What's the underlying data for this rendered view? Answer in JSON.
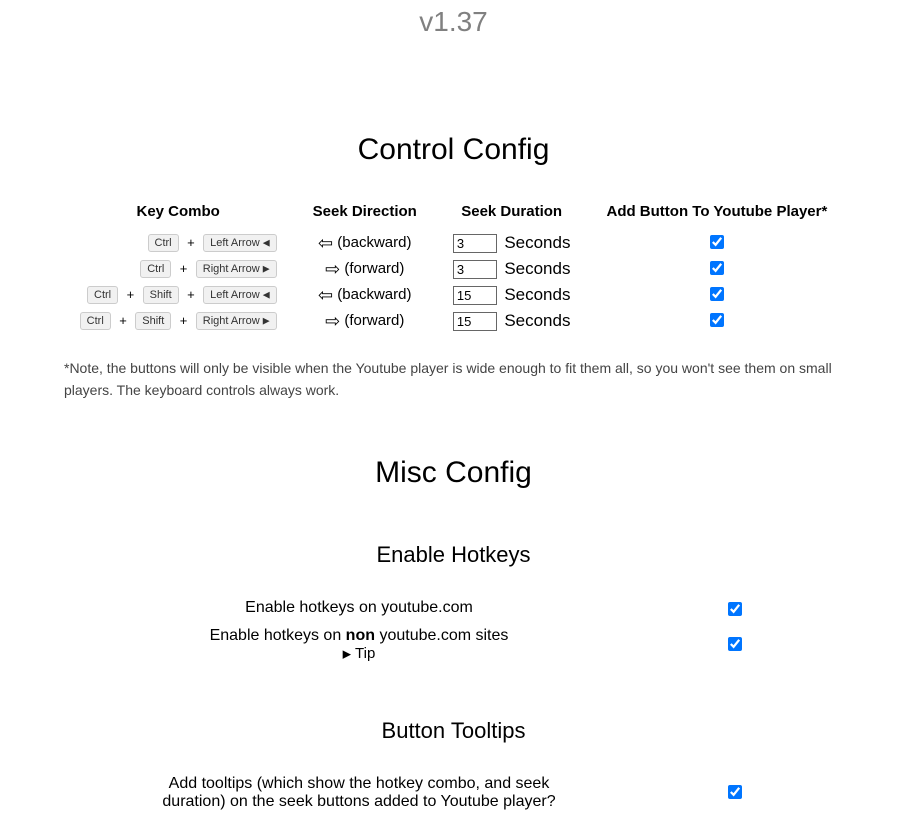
{
  "version": "v1.37",
  "control": {
    "title": "Control Config",
    "headers": {
      "combo": "Key Combo",
      "direction": "Seek Direction",
      "duration": "Seek Duration",
      "addbutton": "Add Button To Youtube Player*"
    },
    "keys": {
      "ctrl": "Ctrl",
      "shift": "Shift",
      "left": "Left Arrow",
      "right": "Right Arrow"
    },
    "plus": "+",
    "dir_backward": "(backward)",
    "dir_forward": "(forward)",
    "seconds_label": "Seconds",
    "rows": [
      {
        "seconds": "3"
      },
      {
        "seconds": "3"
      },
      {
        "seconds": "15"
      },
      {
        "seconds": "15"
      }
    ],
    "note": "*Note, the buttons will only be visible when the Youtube player is wide enough to fit them all, so you won't see them on small players. The keyboard controls always work."
  },
  "misc": {
    "title": "Misc Config",
    "hotkeys": {
      "title": "Enable Hotkeys",
      "row1_label": "Enable hotkeys on youtube.com",
      "row2_prefix": "Enable hotkeys on ",
      "row2_bold": "non",
      "row2_suffix": " youtube.com sites",
      "tip": "Tip"
    },
    "tooltips": {
      "title": "Button Tooltips",
      "label": "Add tooltips (which show the hotkey combo, and seek duration) on the seek buttons added to Youtube player?"
    }
  }
}
